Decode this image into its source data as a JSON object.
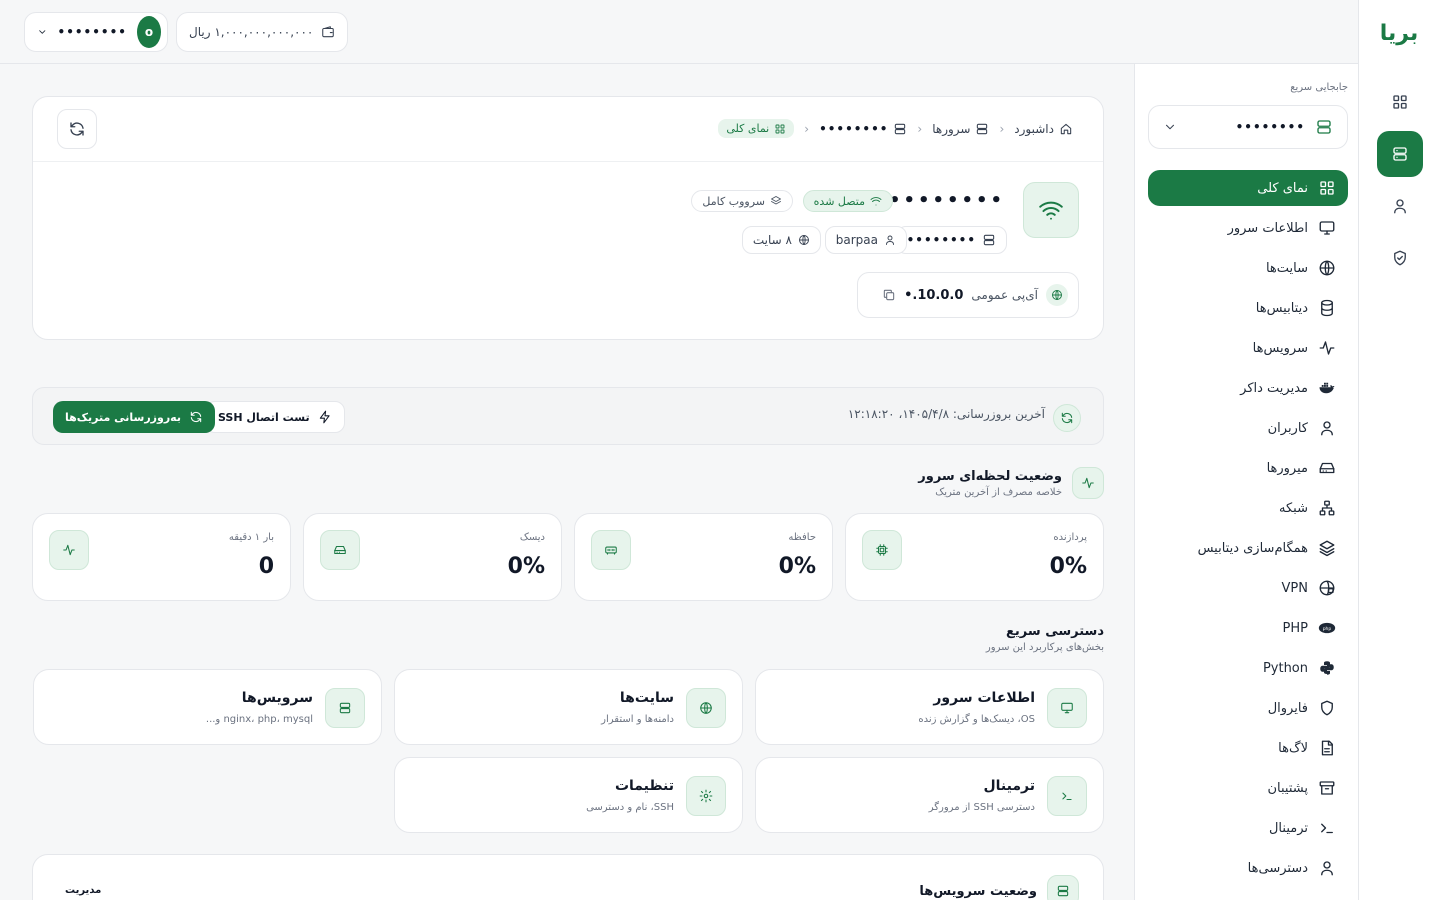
{
  "brand": {
    "logo_text": "بریا"
  },
  "topbar": {
    "balance": "۱,۰۰۰,۰۰۰,۰۰۰,۰۰۰ ریال",
    "user_name": "••••••••",
    "avatar_initial": "o"
  },
  "sidebar": {
    "quick_switch_label": "جابجایی سریع",
    "quick_switch_value": "••••••••",
    "items": [
      {
        "label": "نمای کلی",
        "icon": "dashboard-icon"
      },
      {
        "label": "اطلاعات سرور",
        "icon": "monitor-icon"
      },
      {
        "label": "سایت‌ها",
        "icon": "globe-icon"
      },
      {
        "label": "دیتابیس‌ها",
        "icon": "database-icon"
      },
      {
        "label": "سرویس‌ها",
        "icon": "activity-icon"
      },
      {
        "label": "مدیریت داکر",
        "icon": "docker-icon"
      },
      {
        "label": "کاربران",
        "icon": "user-icon"
      },
      {
        "label": "میرورها",
        "icon": "hard-drive-icon"
      },
      {
        "label": "شبکه",
        "icon": "network-icon"
      },
      {
        "label": "همگام‌سازی دیتابیس",
        "icon": "layers-icon"
      },
      {
        "label": "VPN",
        "icon": "globe-lock-icon"
      },
      {
        "label": "PHP",
        "icon": "php-icon"
      },
      {
        "label": "Python",
        "icon": "python-icon"
      },
      {
        "label": "فایروال",
        "icon": "shield-icon"
      },
      {
        "label": "لاگ‌ها",
        "icon": "file-icon"
      },
      {
        "label": "پشتیبان",
        "icon": "archive-icon"
      },
      {
        "label": "ترمینال",
        "icon": "terminal-icon"
      },
      {
        "label": "دسترسی‌ها",
        "icon": "user-icon"
      }
    ]
  },
  "breadcrumb": {
    "home": "داشبورد",
    "servers": "سرورها",
    "server": "••••••••",
    "current": "نمای کلی"
  },
  "server": {
    "name": "••••••••",
    "status": "متصل شده",
    "stack": "سرووب کامل",
    "host_masked": "••••••••",
    "user": "barpaa",
    "sites": "۸ سایت",
    "ip_label": "آی‌پی عمومی",
    "ip_value": "10.0.0.•"
  },
  "update": {
    "last_update": "آخرین بروزرسانی: ۱۴۰۵/۴/۸، ۱۲:۱۸:۲۰",
    "test_ssh": "تست اتصال SSH",
    "refresh_metrics": "به‌روزرسانی متریک‌ها"
  },
  "live_status": {
    "title": "وضعیت لحظه‌ای سرور",
    "subtitle": "خلاصه مصرف از آخرین متریک",
    "metrics": [
      {
        "label": "پردازنده",
        "value": "0%",
        "icon": "cpu-icon"
      },
      {
        "label": "حافظه",
        "value": "0%",
        "icon": "memory-icon"
      },
      {
        "label": "دیسک",
        "value": "0%",
        "icon": "hard-drive-icon"
      },
      {
        "label": "بار ۱ دقیقه",
        "value": "0",
        "icon": "activity-icon"
      }
    ]
  },
  "quick_access": {
    "title": "دسترسی سریع",
    "subtitle": "بخش‌های پرکاربرد این سرور",
    "items": [
      {
        "title": "اطلاعات سرور",
        "sub": "OS، دیسک‌ها و گزارش زنده",
        "icon": "monitor-icon"
      },
      {
        "title": "سایت‌ها",
        "sub": "دامنه‌ها و استقرار",
        "icon": "globe-icon"
      },
      {
        "title": "سرویس‌ها",
        "sub": "nginx، php، mysql و...",
        "icon": "server-icon"
      },
      {
        "title": "ترمینال",
        "sub": "دسترسی SSH از مرورگر",
        "icon": "terminal-icon"
      },
      {
        "title": "تنظیمات",
        "sub": "SSH، نام و دسترسی",
        "icon": "gear-icon"
      }
    ]
  },
  "services": {
    "title": "وضعیت سرویس‌ها",
    "manage": "مدیریت"
  },
  "colors": {
    "accent": "#1b7a45",
    "accent_soft": "#e7f4ec"
  }
}
